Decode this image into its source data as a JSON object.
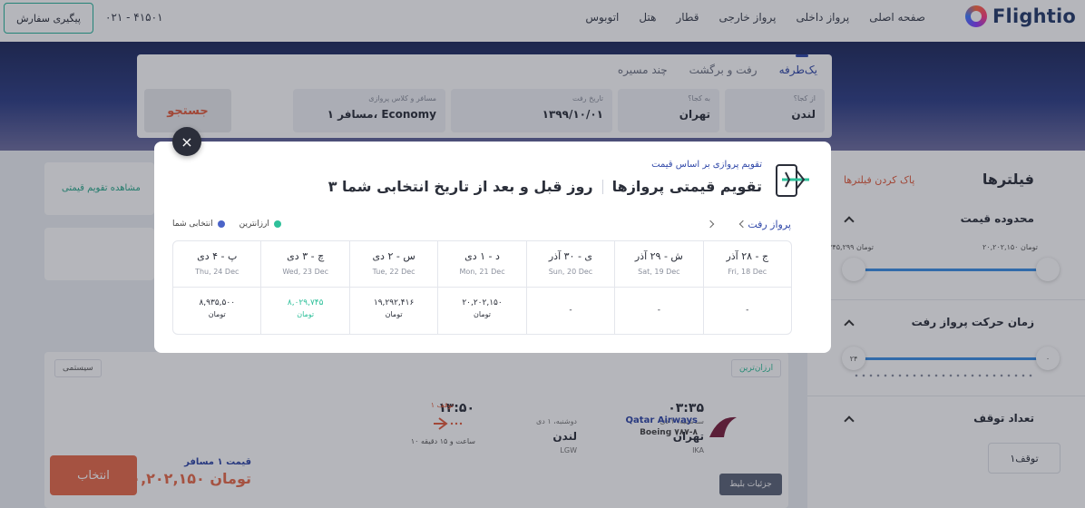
{
  "header": {
    "brand": "Flightio",
    "nav": [
      "صفحه اصلی",
      "پرواز داخلی",
      "پرواز خارجی",
      "قطار",
      "هتل",
      "اتوبوس"
    ],
    "phone": "۰۲۱ - ۴۱۵۰۱",
    "track_order": "پیگیری سفارش"
  },
  "search": {
    "trip_types": [
      "یک‌طرفه",
      "رفت و برگشت",
      "چند مسیره"
    ],
    "from_label": "از کجا؟",
    "from_value": "لندن",
    "to_label": "به کجا؟",
    "to_value": "تهران",
    "date_label": "تاریخ رفت",
    "date_value": "۱۳۹۹/۱۰/۰۱",
    "pax_label": "مسافر و کلاس پروازی",
    "pax_value": "۱ مسافر، Economy",
    "search_button": "جستجو"
  },
  "filters": {
    "title": "فیلترها",
    "clear": "پاک کردن فیلترها",
    "price_range": "محدوده قیمت",
    "price_max": "۲۰,۲۰۲,۱۵۰ تومان",
    "price_min": "۴۲,۳۴۵,۲۹۹ تومان",
    "departure_time": "زمان حرکت پرواز رفت",
    "time_max": "۲۴",
    "time_min": "۰",
    "stops": "تعداد توقف",
    "stop_chip": "۱توقف"
  },
  "calendar_link": "مشاهده تقویم قیمتی",
  "result": {
    "tag_cheapest": "ارزان‌ترین",
    "tag_system": "سیستمی",
    "airline": "Qatar Airways",
    "aircraft": "Boeing ۷۸۷-۸",
    "dep_time": "۱۳:۵۰",
    "dep_date": "دوشنبه، ۱ دی",
    "dep_city": "لندن",
    "dep_code": "LGW",
    "stops": "۱ توقف",
    "duration": "۱۰ ساعت و ۱۵ دقیقه",
    "arr_time": "۰۳:۳۵",
    "arr_date": "سه‌شنبه، ۲ دی",
    "arr_city": "تهران",
    "arr_code": "IKA",
    "price_label": "قیمت ۱ مسافر",
    "price": "۲۰,۲۰۲,۱۵۰ تومان",
    "select": "انتخاب",
    "details": "جزئیات بلیط"
  },
  "modal": {
    "subtitle": "تقویم پروازی بر اساس قیمت",
    "title": "تقویم قیمتی پروازها",
    "title2": "۳ روز قبل و بعد از تاریخ انتخابی شما",
    "route_label": "پرواز رفت",
    "legend_cheapest": "ارزانترین",
    "legend_selected": "انتخابی شما",
    "close": "×",
    "legend_colors": {
      "cheapest": "#2ec09a",
      "selected": "#4b64c8"
    },
    "days": [
      {
        "fa": "ج - ۲۸ آذر",
        "en": "Fri, 18 Dec",
        "price": "-",
        "currency": ""
      },
      {
        "fa": "ش - ۲۹ آذر",
        "en": "Sat, 19 Dec",
        "price": "-",
        "currency": ""
      },
      {
        "fa": "ی - ۳۰ آذر",
        "en": "Sun, 20 Dec",
        "price": "-",
        "currency": ""
      },
      {
        "fa": "د - ۱ دی",
        "en": "Mon, 21 Dec",
        "price": "۲۰,۲۰۲,۱۵۰",
        "currency": "تومان"
      },
      {
        "fa": "س - ۲ دی",
        "en": "Tue, 22 Dec",
        "price": "۱۹,۲۹۲,۴۱۶",
        "currency": "تومان"
      },
      {
        "fa": "چ - ۳ دی",
        "en": "Wed, 23 Dec",
        "price": "۸,۰۲۹,۷۴۵",
        "currency": "تومان"
      },
      {
        "fa": "پ - ۴ دی",
        "en": "Thu, 24 Dec",
        "price": "۸,۹۳۵,۵۰۰",
        "currency": "تومان"
      }
    ]
  }
}
